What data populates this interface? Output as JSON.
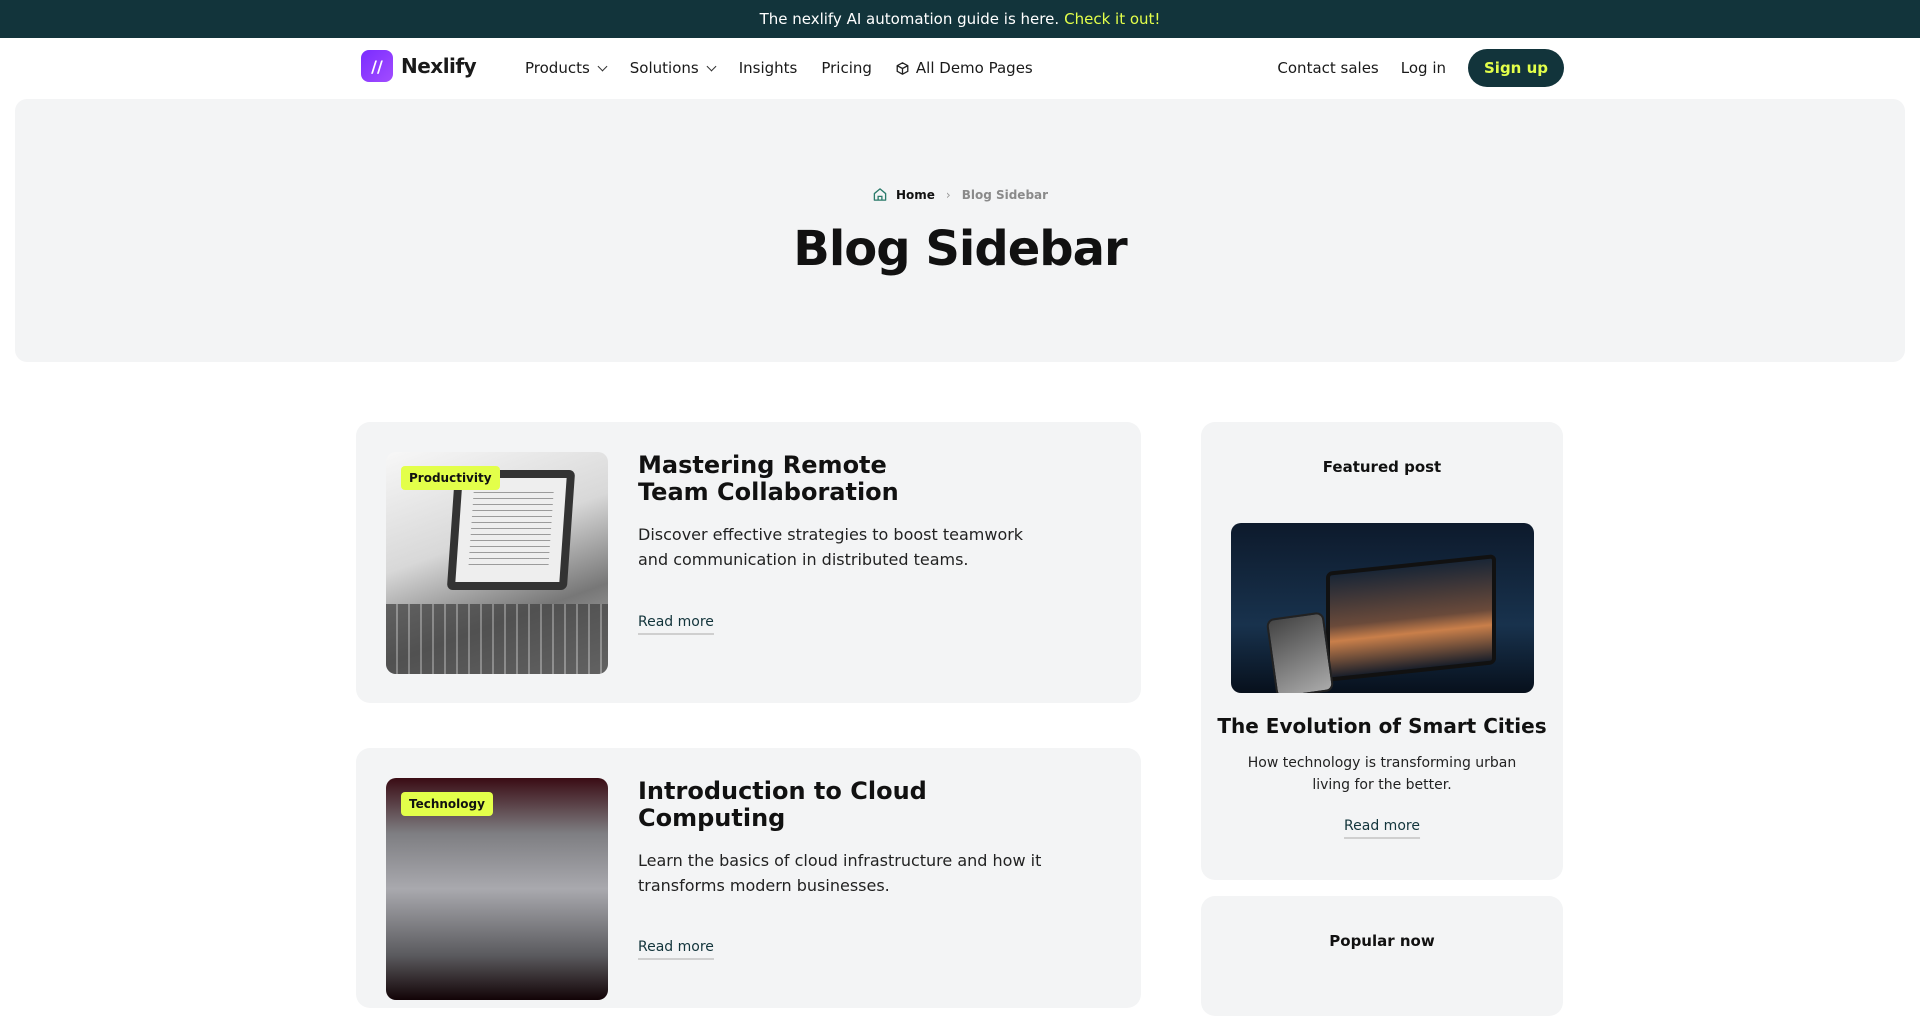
{
  "announcement": {
    "text": "The nexlify AI automation guide is here.",
    "link": "Check it out!"
  },
  "brand": {
    "name": "Nexlify",
    "mark": "//"
  },
  "nav": {
    "items": [
      {
        "label": "Products"
      },
      {
        "label": "Solutions"
      },
      {
        "label": "Insights"
      },
      {
        "label": "Pricing"
      },
      {
        "label": "All Demo Pages"
      }
    ],
    "contact": "Contact sales",
    "login": "Log in",
    "signup": "Sign up"
  },
  "hero": {
    "breadcrumb": {
      "home": "Home",
      "separator": "›",
      "current": "Blog Sidebar"
    },
    "title": "Blog Sidebar"
  },
  "posts": [
    {
      "tag": "Productivity",
      "title": "Mastering Remote Team Collaboration",
      "description": "Discover effective strategies to boost teamwork and communication in distributed teams.",
      "read_more": "Read more"
    },
    {
      "tag": "Technology",
      "title": "Introduction to Cloud Computing",
      "description": "Learn the basics of cloud infrastructure and how it transforms modern businesses.",
      "read_more": "Read more"
    }
  ],
  "sidebar": {
    "featured": {
      "heading": "Featured post",
      "title": "The Evolution of Smart Cities",
      "description": "How technology is transforming urban living for the better.",
      "read_more": "Read more"
    },
    "popular": {
      "heading": "Popular now"
    }
  },
  "colors": {
    "accent": "#e3ff4a",
    "dark": "#12343b",
    "card_bg": "#f3f4f5",
    "logo": "#7a2cff"
  }
}
